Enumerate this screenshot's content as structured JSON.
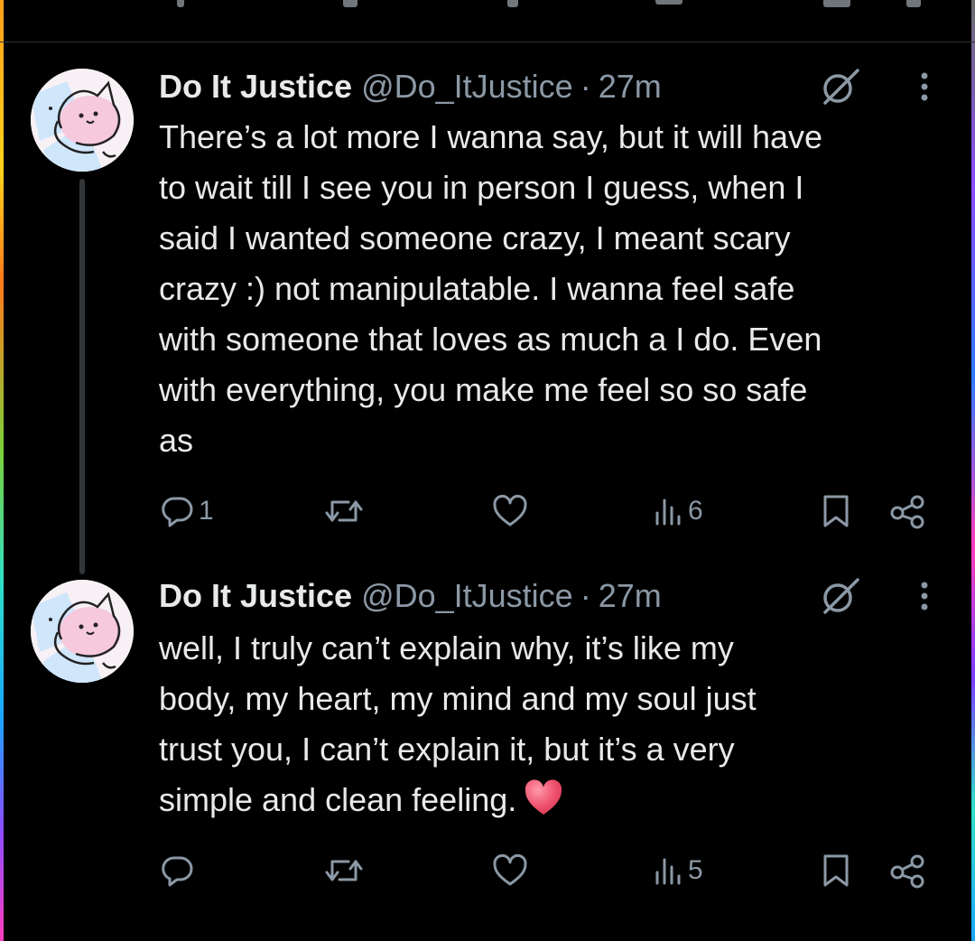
{
  "tweets": [
    {
      "author_name": "Do It Justice",
      "handle": "@Do_ItJustice",
      "separator": "·",
      "time": "27m",
      "text": "There’s a lot more I wanna say, but it will have\nto wait till I see you in person I guess, when I\nsaid I wanted someone crazy, I meant scary\ncrazy :) not manipulatable. I wanna feel safe\nwith someone that loves as much a I do. Even\nwith everything, you make me feel so so safe\nas",
      "emoji": "",
      "replies": "1",
      "retweets": "",
      "likes": "",
      "views": "6"
    },
    {
      "author_name": "Do It Justice",
      "handle": "@Do_ItJustice",
      "separator": "·",
      "time": "27m",
      "text": "well, I truly can’t explain why, it’s like my\nbody, my heart, my mind and my soul just\ntrust you, I can’t explain it, but it’s a very\nsimple and clean feeling.",
      "emoji": "red-heart-emoji",
      "replies": "",
      "retweets": "",
      "likes": "",
      "views": "5"
    }
  ],
  "icons": {
    "reply": "reply-icon",
    "retweet": "retweet-icon",
    "like": "like-icon",
    "views": "views-icon",
    "bookmark": "bookmark-icon",
    "share": "share-icon",
    "grok": "grok-icon",
    "more": "more-icon"
  },
  "colors": {
    "background": "#000000",
    "text": "#e7e9ea",
    "secondary": "#8b98a5",
    "divider": "#2f3336",
    "heart": "#f0546f"
  }
}
